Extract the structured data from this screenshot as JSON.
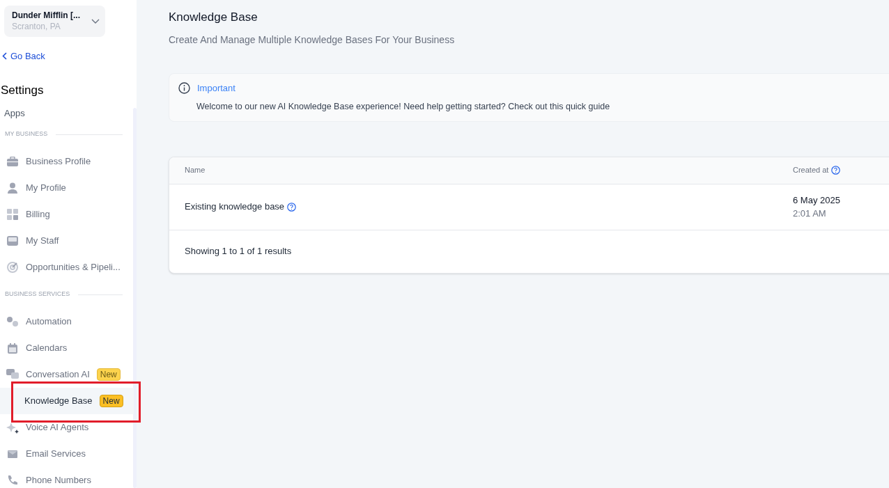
{
  "account": {
    "name": "Dunder Mifflin [...",
    "location": "Scranton, PA"
  },
  "go_back": "Go Back",
  "sidebar": {
    "title": "Settings",
    "top_item": "Apps",
    "sections": [
      {
        "label": "MY BUSINESS",
        "items": [
          {
            "label": "Business Profile",
            "selected": false
          },
          {
            "label": "My Profile",
            "selected": false
          },
          {
            "label": "Billing",
            "selected": false
          },
          {
            "label": "My Staff",
            "selected": false
          },
          {
            "label": "Opportunities & Pipeli...",
            "selected": false
          }
        ]
      },
      {
        "label": "BUSINESS SERVICES",
        "items": [
          {
            "label": "Automation",
            "selected": false
          },
          {
            "label": "Calendars",
            "selected": false
          },
          {
            "label": "Conversation AI",
            "selected": false,
            "badge": "New"
          },
          {
            "label": "Knowledge Base",
            "selected": true,
            "badge": "New",
            "highlighted": true
          },
          {
            "label": "Voice AI Agents",
            "selected": false
          },
          {
            "label": "Email Services",
            "selected": false
          },
          {
            "label": "Phone Numbers",
            "selected": false
          }
        ]
      }
    ]
  },
  "page": {
    "title": "Knowledge Base",
    "subtitle": "Create And Manage Multiple Knowledge Bases For Your Business"
  },
  "notice": {
    "title": "Important",
    "text": "Welcome to our new AI Knowledge Base experience! Need help getting started? Check out this quick guide"
  },
  "table": {
    "columns": [
      "Name",
      "Created at"
    ],
    "rows": [
      {
        "name": "Existing knowledge base",
        "date": "6 May 2025",
        "time": "2:01 AM"
      }
    ],
    "footer": "Showing 1 to 1 of 1 results"
  }
}
